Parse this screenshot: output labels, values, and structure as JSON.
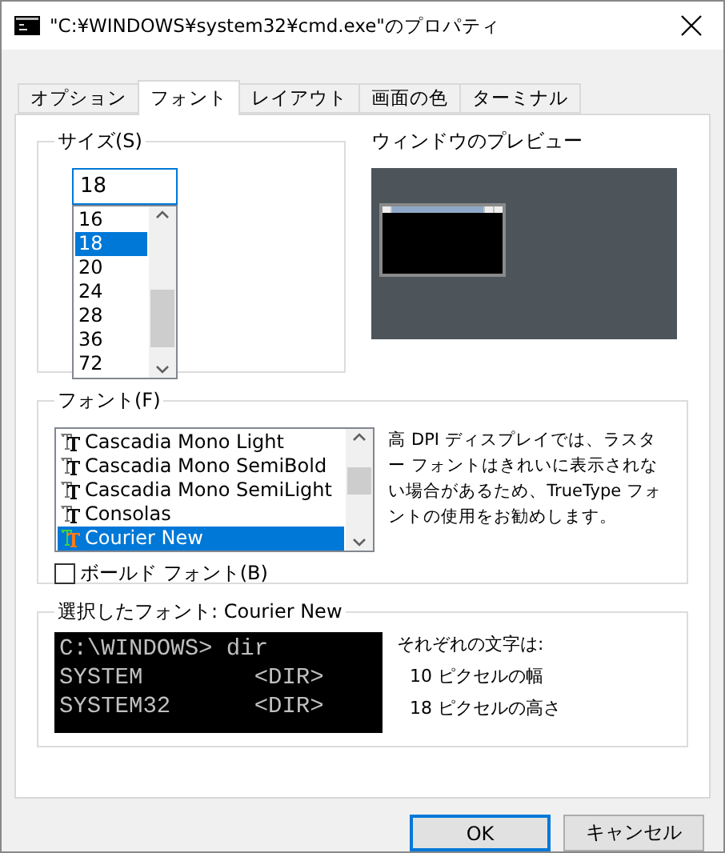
{
  "window": {
    "title": "\"C:¥WINDOWS¥system32¥cmd.exe\"のプロパティ"
  },
  "tabs": [
    {
      "label": "オプション",
      "selected": false
    },
    {
      "label": "フォント",
      "selected": true
    },
    {
      "label": "レイアウト",
      "selected": false
    },
    {
      "label": "画面の色",
      "selected": false
    },
    {
      "label": "ターミナル",
      "selected": false
    }
  ],
  "size": {
    "legend": "サイズ(S)",
    "value": "18",
    "items": [
      {
        "label": "16",
        "selected": false
      },
      {
        "label": "18",
        "selected": true
      },
      {
        "label": "20",
        "selected": false
      },
      {
        "label": "24",
        "selected": false
      },
      {
        "label": "28",
        "selected": false
      },
      {
        "label": "36",
        "selected": false
      },
      {
        "label": "72",
        "selected": false
      }
    ]
  },
  "preview": {
    "label": "ウィンドウのプレビュー"
  },
  "font": {
    "legend": "フォント(F)",
    "items": [
      {
        "label": "Cascadia Mono Light",
        "selected": false
      },
      {
        "label": "Cascadia Mono SemiBold",
        "selected": false
      },
      {
        "label": "Cascadia Mono SemiLight",
        "selected": false
      },
      {
        "label": "Consolas",
        "selected": false
      },
      {
        "label": "Courier New",
        "selected": true
      }
    ],
    "note": "高 DPI ディスプレイでは、ラスター フォントはきれいに表示されない場合があるため、TrueType フォントの使用をお勧めします。",
    "bold": {
      "label": "ボールド フォント(B)",
      "checked": false
    }
  },
  "selected_font": {
    "legend": "選択したフォント: Courier New",
    "sample": [
      "C:\\WINDOWS> dir",
      "SYSTEM        <DIR>",
      "SYSTEM32      <DIR>"
    ],
    "info_title": "それぞれの文字は:",
    "info": [
      "10 ピクセルの幅",
      "18 ピクセルの高さ"
    ]
  },
  "buttons": [
    "OK",
    "キャンセル"
  ]
}
